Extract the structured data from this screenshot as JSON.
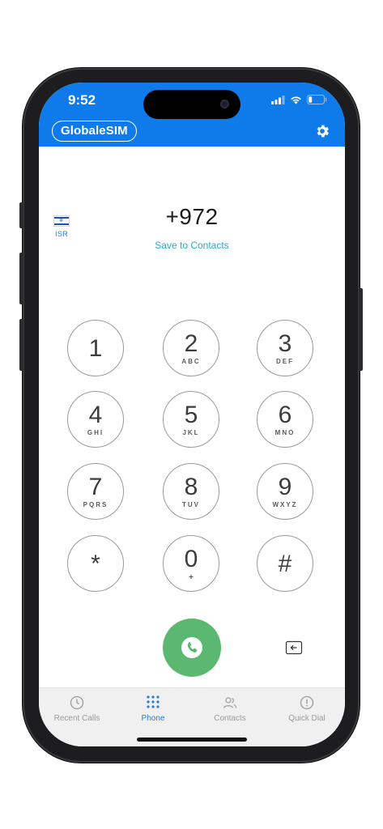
{
  "status": {
    "time": "9:52"
  },
  "header": {
    "brand": "GlobaleSIM"
  },
  "dialer": {
    "country_code": "ISR",
    "number": "+972",
    "save_link": "Save to Contacts"
  },
  "keys": [
    {
      "digit": "1",
      "letters": ""
    },
    {
      "digit": "2",
      "letters": "ABC"
    },
    {
      "digit": "3",
      "letters": "DEF"
    },
    {
      "digit": "4",
      "letters": "GHI"
    },
    {
      "digit": "5",
      "letters": "JKL"
    },
    {
      "digit": "6",
      "letters": "MNO"
    },
    {
      "digit": "7",
      "letters": "PQRS"
    },
    {
      "digit": "8",
      "letters": "TUV"
    },
    {
      "digit": "9",
      "letters": "WXYZ"
    },
    {
      "digit": "*",
      "letters": ""
    },
    {
      "digit": "0",
      "letters": "+"
    },
    {
      "digit": "#",
      "letters": ""
    }
  ],
  "tabs": [
    {
      "label": "Recent Calls",
      "icon": "clock-icon"
    },
    {
      "label": "Phone",
      "icon": "keypad-grid-icon",
      "active": true
    },
    {
      "label": "Contacts",
      "icon": "people-icon"
    },
    {
      "label": "Quick Dial",
      "icon": "alert-circle-icon"
    }
  ],
  "colors": {
    "header_blue": "#0f7bea",
    "call_green": "#5bb870",
    "active_tab": "#2a7ad8",
    "link": "#2aa9c4"
  }
}
